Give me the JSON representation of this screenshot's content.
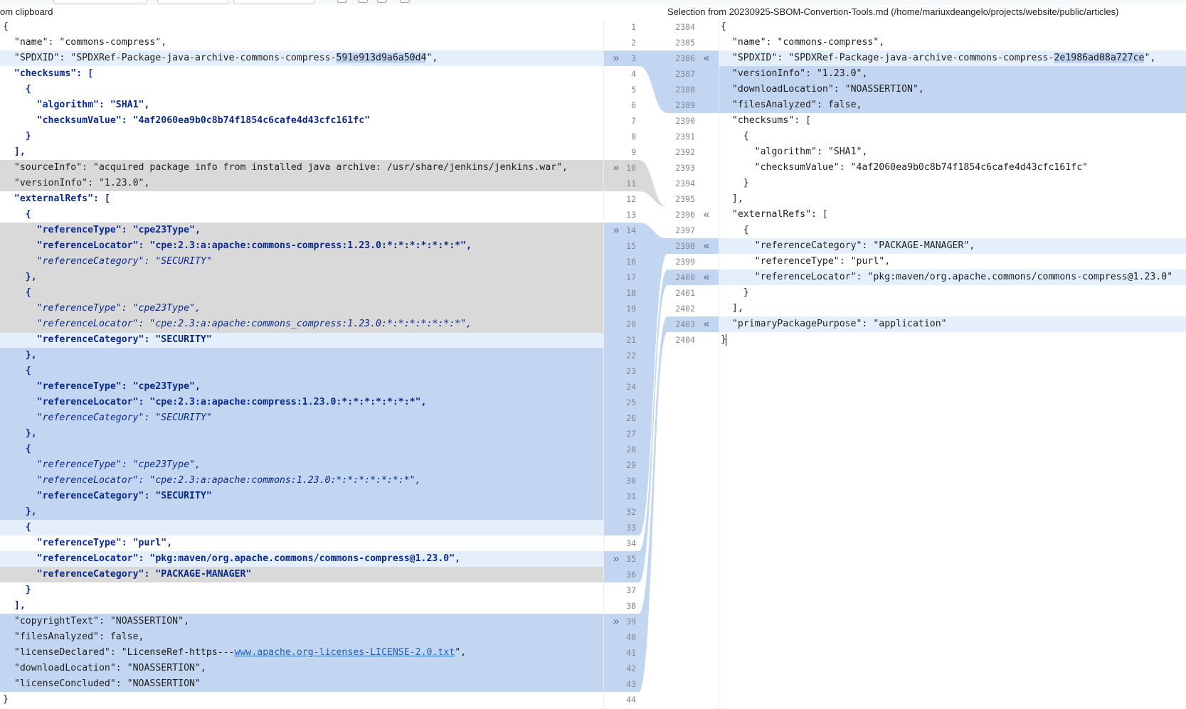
{
  "colors": {
    "changed": "#c2d6f1",
    "inserted_light": "#e5eefb",
    "ignored": "#d9d9d9",
    "key": "#1f1f1f",
    "string": "#1f1f1f",
    "bold_key": "#0a2a8f",
    "italic_key": "#0a2a8f",
    "link": "#1f5fbf"
  },
  "headers": {
    "left": "om clipboard",
    "right": "Selection from 20230925-SBOM-Convertion-Tools.md (/home/mariuxdeangelo/projects/website/public/articles)"
  },
  "left_lines": [
    {
      "n": "1",
      "text": "{",
      "bg": "none"
    },
    {
      "n": "2",
      "text": "  \"name\": \"commons-compress\",",
      "bg": "none"
    },
    {
      "n": "3",
      "text": "  \"SPDXID\": \"SPDXRef-Package-java-archive-commons-compress-591e913d9a6a50d4\",",
      "bg": "light",
      "hl": "591e913d9a6a50d4",
      "arrow": "»"
    },
    {
      "n": "4",
      "text": "  \"checksums\": [",
      "bg": "none",
      "style": "bracket"
    },
    {
      "n": "5",
      "text": "    {",
      "bg": "none",
      "style": "bracket"
    },
    {
      "n": "6",
      "text": "      \"algorithm\": \"SHA1\",",
      "bg": "none",
      "style": "bold"
    },
    {
      "n": "7",
      "text": "      \"checksumValue\": \"4af2060ea9b0c8b74f1854c6cafe4d43cfc161fc\"",
      "bg": "none",
      "style": "bold"
    },
    {
      "n": "8",
      "text": "    }",
      "bg": "none",
      "style": "bracket"
    },
    {
      "n": "9",
      "text": "  ],",
      "bg": "none",
      "style": "bracket"
    },
    {
      "n": "10",
      "text": "  \"sourceInfo\": \"acquired package info from installed java archive: /usr/share/jenkins/jenkins.war\",",
      "bg": "ignored",
      "arrow": "»"
    },
    {
      "n": "11",
      "text": "  \"versionInfo\": \"1.23.0\",",
      "bg": "ignored"
    },
    {
      "n": "12",
      "text": "  \"externalRefs\": [",
      "bg": "none",
      "style": "bracket"
    },
    {
      "n": "13",
      "text": "    {",
      "bg": "none",
      "style": "bracket"
    },
    {
      "n": "14",
      "text": "      \"referenceType\": \"cpe23Type\",",
      "bg": "ignored",
      "style": "bold",
      "arrow": "»"
    },
    {
      "n": "15",
      "text": "      \"referenceLocator\": \"cpe:2.3:a:apache:commons-compress:1.23.0:*:*:*:*:*:*:*\",",
      "bg": "ignored",
      "style": "bold"
    },
    {
      "n": "16",
      "text": "      \"referenceCategory\": \"SECURITY\"",
      "bg": "ignored",
      "style": "italic"
    },
    {
      "n": "17",
      "text": "    },",
      "bg": "ignored",
      "style": "bracket"
    },
    {
      "n": "18",
      "text": "    {",
      "bg": "ignored",
      "style": "bracket"
    },
    {
      "n": "19",
      "text": "      \"referenceType\": \"cpe23Type\",",
      "bg": "ignored",
      "style": "italic"
    },
    {
      "n": "20",
      "text": "      \"referenceLocator\": \"cpe:2.3:a:apache:commons_compress:1.23.0:*:*:*:*:*:*:*\",",
      "bg": "ignored",
      "style": "italic"
    },
    {
      "n": "21",
      "text": "      \"referenceCategory\": \"SECURITY\"",
      "bg": "split",
      "style": "bold"
    },
    {
      "n": "22",
      "text": "    },",
      "bg": "changed",
      "style": "bracket"
    },
    {
      "n": "23",
      "text": "    {",
      "bg": "changed",
      "style": "bracket"
    },
    {
      "n": "24",
      "text": "      \"referenceType\": \"cpe23Type\",",
      "bg": "changed",
      "style": "bold"
    },
    {
      "n": "25",
      "text": "      \"referenceLocator\": \"cpe:2.3:a:apache:compress:1.23.0:*:*:*:*:*:*:*\",",
      "bg": "changed",
      "style": "bold"
    },
    {
      "n": "26",
      "text": "      \"referenceCategory\": \"SECURITY\"",
      "bg": "changed",
      "style": "italic"
    },
    {
      "n": "27",
      "text": "    },",
      "bg": "changed",
      "style": "bracket"
    },
    {
      "n": "28",
      "text": "    {",
      "bg": "changed",
      "style": "bracket"
    },
    {
      "n": "29",
      "text": "      \"referenceType\": \"cpe23Type\",",
      "bg": "changed",
      "style": "italic"
    },
    {
      "n": "30",
      "text": "      \"referenceLocator\": \"cpe:2.3:a:apache:commons:1.23.0:*:*:*:*:*:*:*\",",
      "bg": "changed",
      "style": "italic"
    },
    {
      "n": "31",
      "text": "      \"referenceCategory\": \"SECURITY\"",
      "bg": "changed",
      "style": "bold"
    },
    {
      "n": "32",
      "text": "    },",
      "bg": "changed",
      "style": "bracket"
    },
    {
      "n": "33",
      "text": "    {",
      "bg": "light",
      "style": "bracket"
    },
    {
      "n": "34",
      "text": "      \"referenceType\": \"purl\",",
      "bg": "none",
      "style": "bold"
    },
    {
      "n": "35",
      "text": "      \"referenceLocator\": \"pkg:maven/org.apache.commons/commons-compress@1.23.0\",",
      "bg": "light",
      "style": "bold",
      "arrow": "»"
    },
    {
      "n": "36",
      "text": "      \"referenceCategory\": \"PACKAGE-MANAGER\"",
      "bg": "ignored",
      "style": "bold"
    },
    {
      "n": "37",
      "text": "    }",
      "bg": "none",
      "style": "bracket"
    },
    {
      "n": "38",
      "text": "  ],",
      "bg": "none",
      "style": "bracket"
    },
    {
      "n": "39",
      "text": "  \"copyrightText\": \"NOASSERTION\",",
      "bg": "changed",
      "arrow": "»"
    },
    {
      "n": "40",
      "text": "  \"filesAnalyzed\": false,",
      "bg": "changed"
    },
    {
      "n": "41",
      "text": "  \"licenseDeclared\": \"LicenseRef-https---www.apache.org-licenses-LICENSE-2.0.txt\",",
      "bg": "changed",
      "link": "www.apache.org-licenses-LICENSE-2.0.txt"
    },
    {
      "n": "42",
      "text": "  \"downloadLocation\": \"NOASSERTION\",",
      "bg": "changed"
    },
    {
      "n": "43",
      "text": "  \"licenseConcluded\": \"NOASSERTION\"",
      "bg": "changed"
    },
    {
      "n": "44",
      "text": "}",
      "bg": "none"
    }
  ],
  "right_lines": [
    {
      "n": "2384",
      "text": "{",
      "bg": "none"
    },
    {
      "n": "2385",
      "text": "  \"name\": \"commons-compress\",",
      "bg": "none"
    },
    {
      "n": "2386",
      "text": "  \"SPDXID\": \"SPDXRef-Package-java-archive-commons-compress-2e1986ad08a727ce\",",
      "bg": "light",
      "hl": "2e1986ad08a727ce",
      "arrow": "«"
    },
    {
      "n": "2387",
      "text": "  \"versionInfo\": \"1.23.0\",",
      "bg": "changed"
    },
    {
      "n": "2388",
      "text": "  \"downloadLocation\": \"NOASSERTION\",",
      "bg": "changed"
    },
    {
      "n": "2389",
      "text": "  \"filesAnalyzed\": false,",
      "bg": "changed"
    },
    {
      "n": "2390",
      "text": "  \"checksums\": [",
      "bg": "none"
    },
    {
      "n": "2391",
      "text": "    {",
      "bg": "none"
    },
    {
      "n": "2392",
      "text": "      \"algorithm\": \"SHA1\",",
      "bg": "none"
    },
    {
      "n": "2393",
      "text": "      \"checksumValue\": \"4af2060ea9b0c8b74f1854c6cafe4d43cfc161fc\"",
      "bg": "none"
    },
    {
      "n": "2394",
      "text": "    }",
      "bg": "none"
    },
    {
      "n": "2395",
      "text": "  ],",
      "bg": "none"
    },
    {
      "n": "2396",
      "text": "  \"externalRefs\": [",
      "bg": "none",
      "arrow": "«"
    },
    {
      "n": "2397",
      "text": "    {",
      "bg": "none"
    },
    {
      "n": "2398",
      "text": "      \"referenceCategory\": \"PACKAGE-MANAGER\",",
      "bg": "light",
      "arrow": "«"
    },
    {
      "n": "2399",
      "text": "      \"referenceType\": \"purl\",",
      "bg": "none"
    },
    {
      "n": "2400",
      "text": "      \"referenceLocator\": \"pkg:maven/org.apache.commons/commons-compress@1.23.0\"",
      "bg": "light",
      "arrow": "«"
    },
    {
      "n": "2401",
      "text": "    }",
      "bg": "none"
    },
    {
      "n": "2402",
      "text": "  ],",
      "bg": "none"
    },
    {
      "n": "2403",
      "text": "  \"primaryPackagePurpose\": \"application\"",
      "bg": "light",
      "arrow": "«"
    },
    {
      "n": "2404",
      "text": "}",
      "bg": "none",
      "caret": true
    }
  ]
}
